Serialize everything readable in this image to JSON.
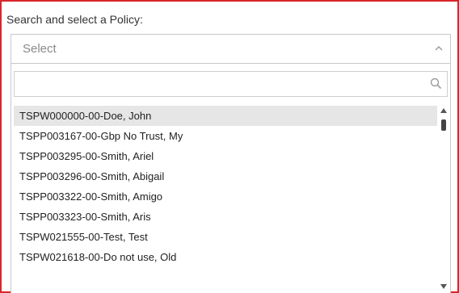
{
  "form": {
    "label": "Search and select a Policy:",
    "select_placeholder": "Select"
  },
  "search": {
    "value": "",
    "placeholder": ""
  },
  "icons": {
    "select_toggle": "chevron-up-icon",
    "search": "search-icon",
    "scroll_up": "scroll-up-arrow-icon",
    "scroll_down": "scroll-down-arrow-icon"
  },
  "colors": {
    "frame_border": "#d9262b",
    "highlight_row": "#e6e6e6"
  },
  "policies": [
    "TSPW000000-00-Doe, John",
    "TSPP003167-00-Gbp No Trust, My",
    "TSPP003295-00-Smith, Ariel",
    "TSPP003296-00-Smith, Abigail",
    "TSPP003322-00-Smith, Amigo",
    "TSPP003323-00-Smith, Aris",
    "TSPW021555-00-Test, Test",
    "TSPW021618-00-Do not use, Old"
  ],
  "highlighted_index": 0
}
